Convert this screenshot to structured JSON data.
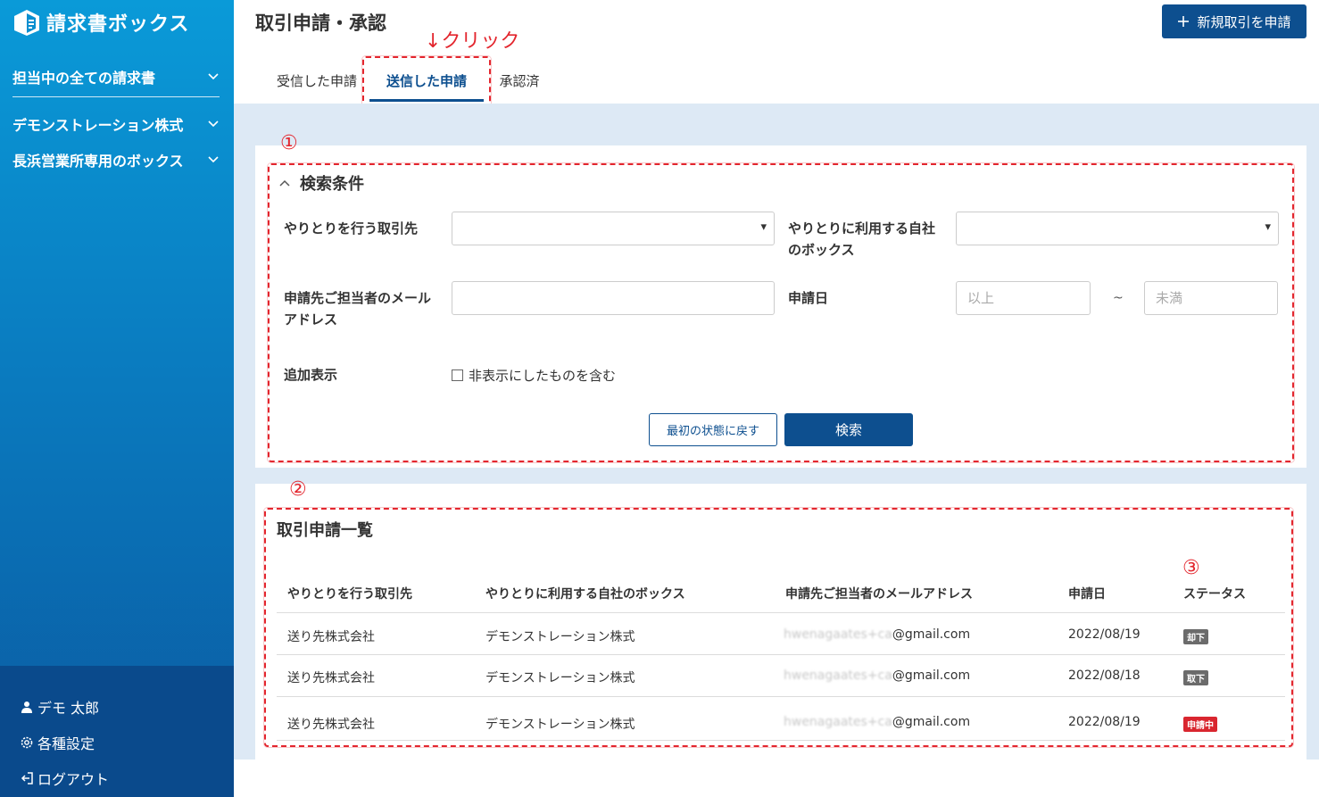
{
  "app": {
    "name": "請求書ボックス"
  },
  "sidebar": {
    "items": [
      {
        "label": "担当中の全ての請求書"
      },
      {
        "label": "デモンストレーション株式"
      },
      {
        "label": "長浜営業所専用のボックス"
      }
    ],
    "bottom": {
      "user": "デモ 太郎",
      "settings": "各種設定",
      "logout": "ログアウト"
    }
  },
  "header": {
    "title": "取引申請・承認",
    "new_button": "新規取引を申請"
  },
  "annotation": {
    "click": "↓クリック",
    "n1": "①",
    "n2": "②",
    "n3": "③"
  },
  "tabs": [
    {
      "label": "受信した申請"
    },
    {
      "label": "送信した申請"
    },
    {
      "label": "承認済"
    }
  ],
  "search": {
    "heading": "検索条件",
    "partner_label": "やりとりを行う取引先",
    "box_label": "やりとりに利用する自社のボックス",
    "email_label": "申請先ご担当者のメールアドレス",
    "date_label": "申請日",
    "date_from_placeholder": "以上",
    "date_to_placeholder": "未満",
    "tilde": "~",
    "extra_label": "追加表示",
    "include_hidden": "非表示にしたものを含む",
    "reset_button": "最初の状態に戻す",
    "search_button": "検索"
  },
  "list": {
    "heading": "取引申請一覧",
    "columns": [
      "やりとりを行う取引先",
      "やりとりに利用する自社のボックス",
      "申請先ご担当者のメールアドレス",
      "申請日",
      "ステータス"
    ],
    "rows": [
      {
        "partner": "送り先株式会社",
        "box": "デモンストレーション株式",
        "email_hidden": "hwenagaates+ca",
        "email_domain": "@gmail.com",
        "date": "2022/08/19",
        "status": "却下"
      },
      {
        "partner": "送り先株式会社",
        "box": "デモンストレーション株式",
        "email_hidden": "hwenagaates+ca",
        "email_domain": "@gmail.com",
        "date": "2022/08/18",
        "status": "取下"
      },
      {
        "partner": "送り先株式会社",
        "box": "デモンストレーション株式",
        "email_hidden": "hwenagaates+ca",
        "email_domain": "@gmail.com",
        "date": "2022/08/19",
        "status": "申請中"
      }
    ]
  },
  "colors": {
    "primary": "#0d4f8f",
    "annotation": "#e3262e",
    "sidebar": "#0a7cc0",
    "main_bg": "#dde9f5"
  }
}
